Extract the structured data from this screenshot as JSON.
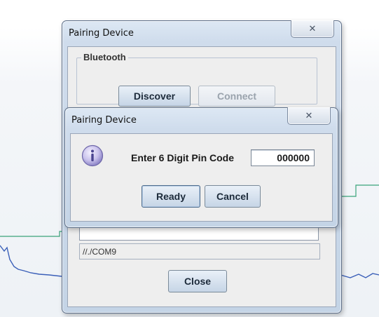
{
  "main_window": {
    "title": "Pairing Device",
    "close_glyph": "✕",
    "bluetooth_group": "Bluetooth",
    "discover_label": "Discover",
    "connect_label": "Connect",
    "port_value": "//./COM9",
    "close_label": "Close"
  },
  "dialog": {
    "title": "Pairing Device",
    "close_glyph": "✕",
    "icon": "info-icon",
    "prompt": "Enter 6 Digit Pin Code",
    "pin_value": "000000",
    "ready_label": "Ready",
    "cancel_label": "Cancel"
  },
  "colors": {
    "plot_line_green": "#3aa37a",
    "plot_line_blue": "#3a5fb8",
    "button_text": "#1c2a3a",
    "disabled_text": "#9aa3ad"
  }
}
